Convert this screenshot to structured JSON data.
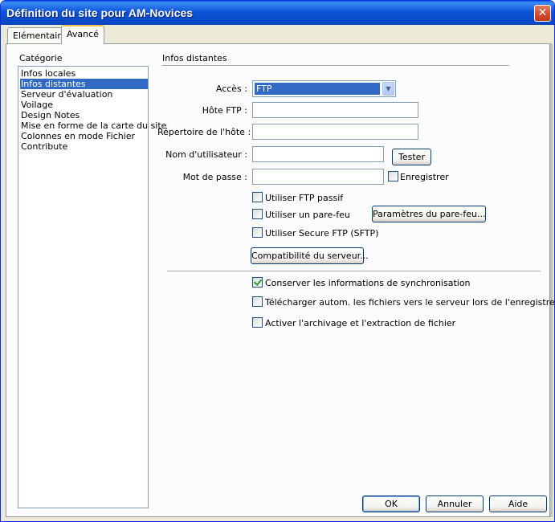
{
  "window": {
    "title": "Définition du site pour AM-Novices",
    "close_icon": "close-icon"
  },
  "tabs": [
    {
      "label": "Elémentaire"
    },
    {
      "label": "Avancé"
    }
  ],
  "category": {
    "heading": "Catégorie",
    "items": [
      "Infos locales",
      "Infos distantes",
      "Serveur d'évaluation",
      "Voilage",
      "Design Notes",
      "Mise en forme de la carte du site",
      "Colonnes en mode Fichier",
      "Contribute"
    ],
    "selected_index": 1
  },
  "remote": {
    "section_title": "Infos distantes",
    "access_label": "Accès :",
    "access_value": "FTP",
    "host_label": "Hôte FTP :",
    "host_value": "",
    "dir_label": "Répertoire de l'hôte :",
    "dir_value": "",
    "user_label": "Nom d'utilisateur :",
    "user_value": "",
    "test_button": "Tester",
    "pass_label": "Mot de passe :",
    "pass_value": "",
    "save_label": "Enregistrer",
    "save_checked": false,
    "passive_ftp_label": "Utiliser FTP passif",
    "passive_ftp_checked": false,
    "firewall_label": "Utiliser un pare-feu",
    "firewall_checked": false,
    "firewall_settings_button": "Paramètres du pare-feu...",
    "sftp_label": "Utiliser Secure FTP (SFTP)",
    "sftp_checked": false,
    "server_compat_button": "Compatibilité du serveur...",
    "sync_label": "Conserver les informations de synchronisation",
    "sync_checked": true,
    "auto_upload_label": "Télécharger autom. les fichiers vers le serveur lors de l'enregistrement",
    "auto_upload_checked": false,
    "checkin_label": "Activer l'archivage et l'extraction de fichier",
    "checkin_checked": false
  },
  "footer": {
    "ok": "OK",
    "cancel": "Annuler",
    "help": "Aide"
  },
  "colors": {
    "titlebar": "#0a4bc8",
    "selection": "#316ac5",
    "dialog_bg": "#ece9d8"
  }
}
